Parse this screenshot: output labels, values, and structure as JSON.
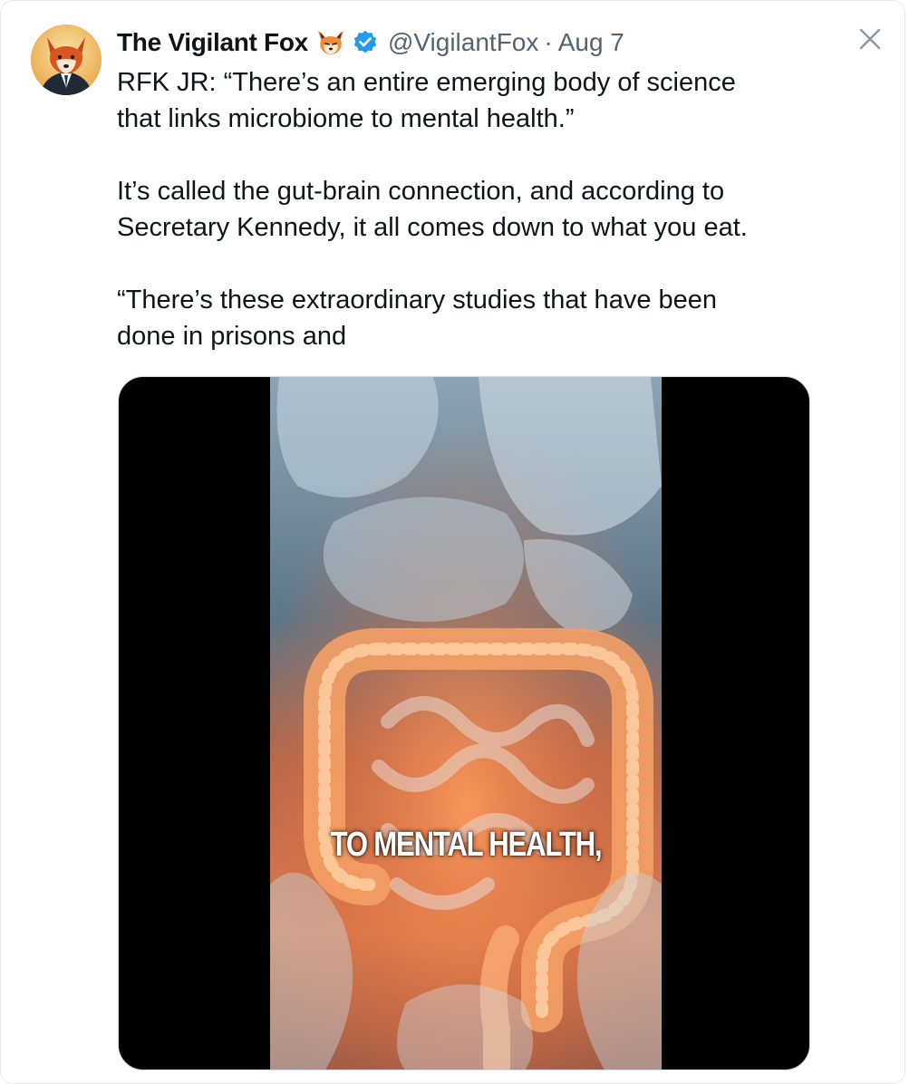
{
  "tweet": {
    "display_name": "The Vigilant Fox",
    "name_emoji": "fox-face-emoji",
    "verified": true,
    "handle": "@VigilantFox",
    "separator": "·",
    "date": "Aug 7",
    "paragraphs": [
      "RFK JR: “There’s an entire emerging body of science\nthat links microbiome to mental health.”",
      "It’s called the gut-brain connection, and according to\nSecretary Kennedy, it all comes down to what you eat.",
      "“There’s these extraordinary studies that have been\ndone in prisons and"
    ]
  },
  "media": {
    "type": "video",
    "caption": "TO MENTAL HEALTH,"
  },
  "icons": {
    "close": "close-icon",
    "verified": "verified-badge-icon",
    "avatar": "fox-avatar"
  },
  "colors": {
    "text_primary": "#0f1419",
    "text_secondary": "#536471",
    "verified_blue": "#1d9bf0",
    "media_background": "#000000"
  }
}
